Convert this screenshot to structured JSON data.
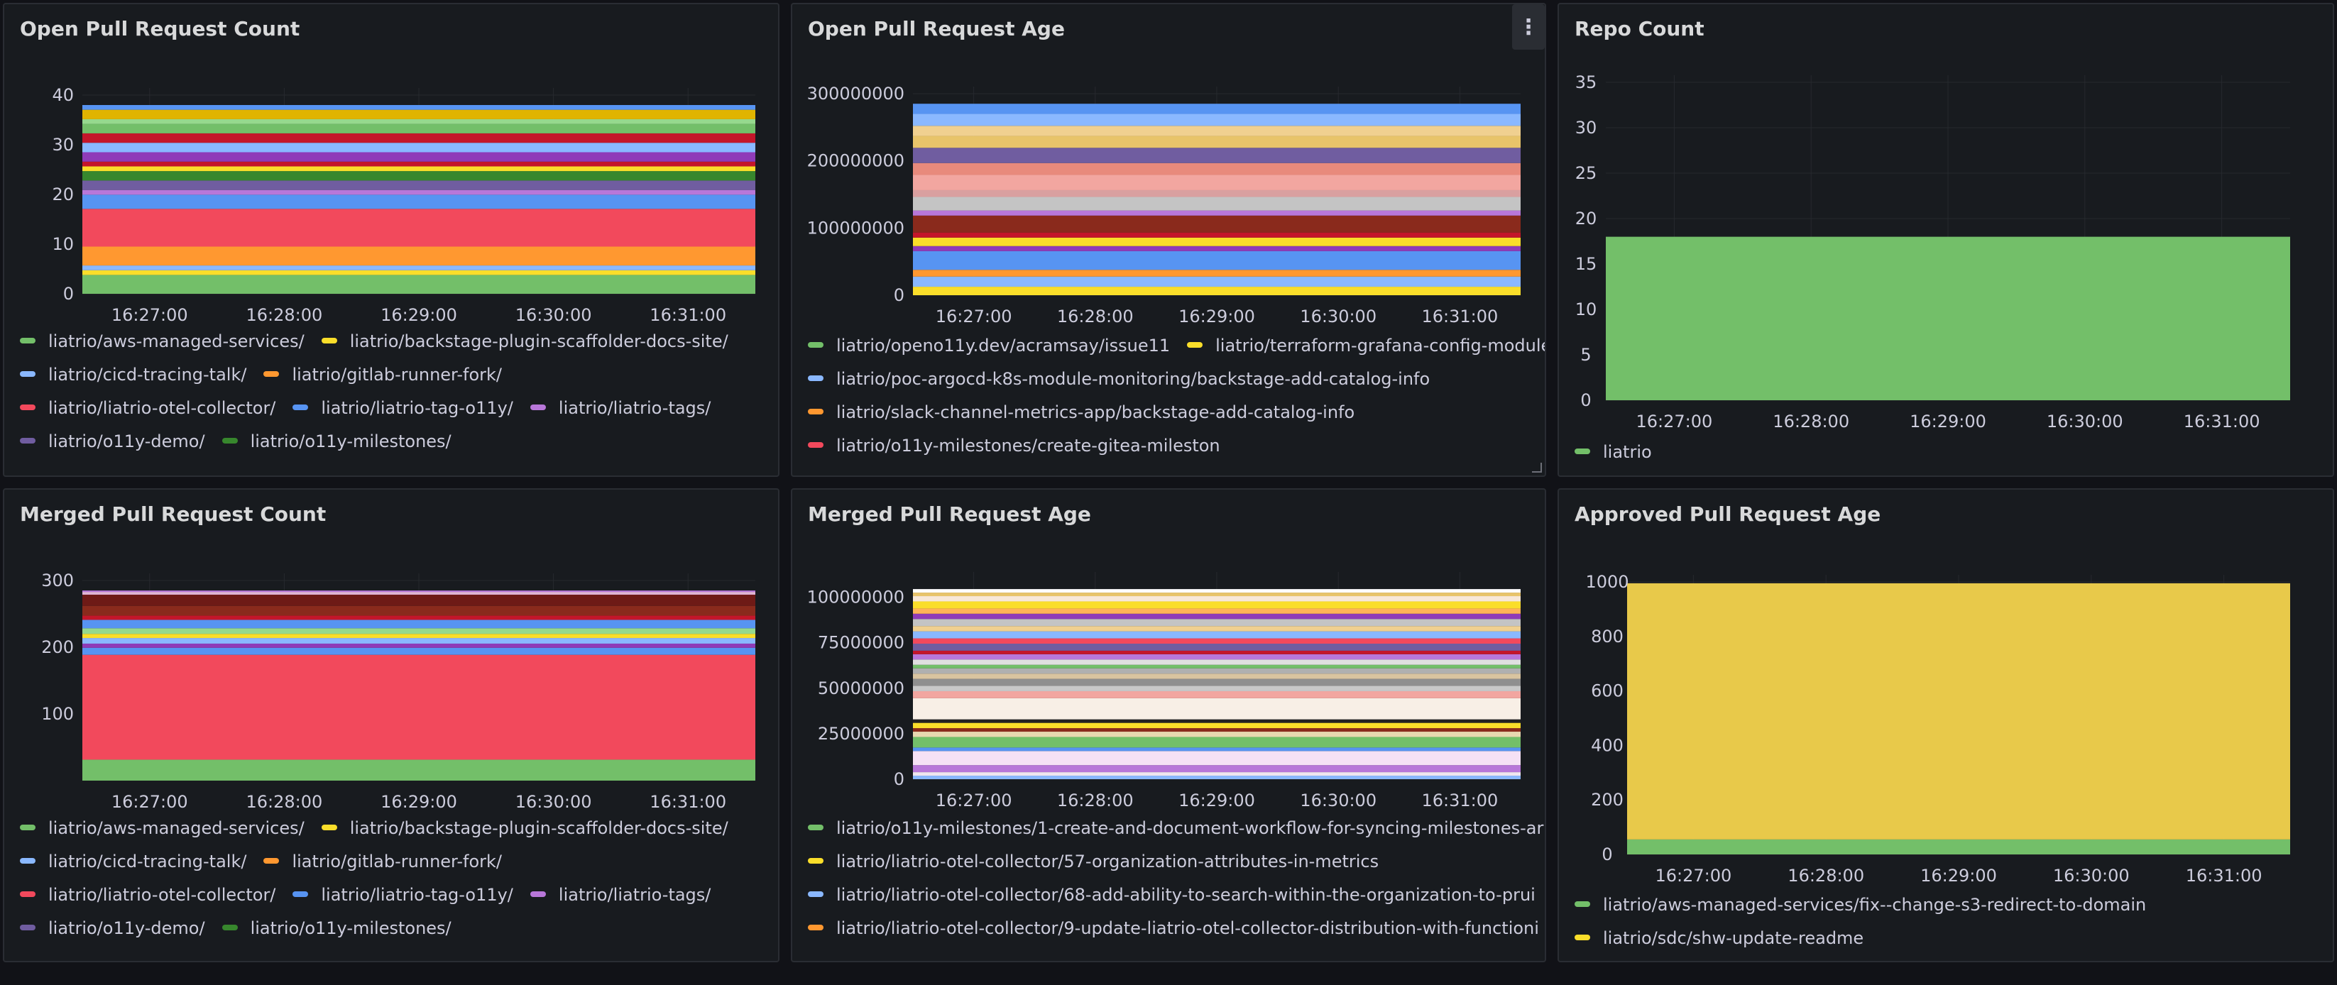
{
  "colors": {
    "background": "#111217",
    "panel": "#181b1f",
    "border": "#2a2d33",
    "text": "#ccccdc",
    "grid": "#26292e"
  },
  "panels": [
    {
      "id": "open-pr-count",
      "title": "Open Pull Request Count",
      "menu": false
    },
    {
      "id": "open-pr-age",
      "title": "Open Pull Request Age",
      "menu": true
    },
    {
      "id": "repo-count",
      "title": "Repo Count",
      "menu": false
    },
    {
      "id": "merged-pr-count",
      "title": "Merged Pull Request Count",
      "menu": false
    },
    {
      "id": "merged-pr-age",
      "title": "Merged Pull Request Age",
      "menu": false
    },
    {
      "id": "approved-pr-age",
      "title": "Approved Pull Request Age",
      "menu": false
    }
  ],
  "chart_data": [
    {
      "type": "area",
      "stacked": true,
      "title": "Open Pull Request Count",
      "x": [
        "16:27:00",
        "16:28:00",
        "16:29:00",
        "16:30:00",
        "16:31:00"
      ],
      "ylim": [
        0,
        40
      ],
      "yticks": [
        "0",
        "10",
        "20",
        "30",
        "40"
      ],
      "grid": true,
      "bands": [
        {
          "v": 4,
          "c": "#73bf69"
        },
        {
          "v": 1,
          "c": "#fade2a"
        },
        {
          "v": 1,
          "c": "#8ab8ff"
        },
        {
          "v": 4,
          "c": "#ff9830"
        },
        {
          "v": 8,
          "c": "#f2495c"
        },
        {
          "v": 3,
          "c": "#5794f2"
        },
        {
          "v": 1,
          "c": "#b877d9"
        },
        {
          "v": 2,
          "c": "#705da0"
        },
        {
          "v": 2,
          "c": "#37872d"
        },
        {
          "v": 1,
          "c": "#fade2a"
        },
        {
          "v": 1,
          "c": "#c4162a"
        },
        {
          "v": 2,
          "c": "#8f3bb8"
        },
        {
          "v": 2,
          "c": "#8ab8ff"
        },
        {
          "v": 2,
          "c": "#c4162a"
        },
        {
          "v": 2,
          "c": "#73bf69"
        },
        {
          "v": 1,
          "c": "#96d98d"
        },
        {
          "v": 2,
          "c": "#e0b400"
        },
        {
          "v": 1,
          "c": "#5794f2"
        }
      ],
      "legend": [
        [
          "liatrio/aws-managed-services/",
          "liatrio/backstage-plugin-scaffolder-docs-site/"
        ],
        [
          "liatrio/cicd-tracing-talk/",
          "liatrio/gitlab-runner-fork/"
        ],
        [
          "liatrio/liatrio-otel-collector/",
          "liatrio/liatrio-tag-o11y/",
          "liatrio/liatrio-tags/"
        ],
        [
          "liatrio/o11y-demo/",
          "liatrio/o11y-milestones/"
        ]
      ],
      "legend_colors": [
        [
          "#73bf69",
          "#fade2a"
        ],
        [
          "#8ab8ff",
          "#ff9830"
        ],
        [
          "#f2495c",
          "#5794f2",
          "#b877d9"
        ],
        [
          "#705da0",
          "#37872d"
        ]
      ]
    },
    {
      "type": "area",
      "stacked": true,
      "title": "Open Pull Request Age",
      "x": [
        "16:27:00",
        "16:28:00",
        "16:29:00",
        "16:30:00",
        "16:31:00"
      ],
      "ylim": [
        0,
        300000000
      ],
      "yticks": [
        "0",
        "100000000",
        "200000000",
        "300000000"
      ],
      "grid": true,
      "bands": [
        {
          "v": 10,
          "c": "#fade2a"
        },
        {
          "v": 12,
          "c": "#8ab8ff"
        },
        {
          "v": 8,
          "c": "#ff9830"
        },
        {
          "v": 22,
          "c": "#5794f2"
        },
        {
          "v": 6,
          "c": "#8f3bb8"
        },
        {
          "v": 10,
          "c": "#fade2a"
        },
        {
          "v": 6,
          "c": "#c4162a"
        },
        {
          "v": 20,
          "c": "#8a2a1c"
        },
        {
          "v": 6,
          "c": "#b877d9"
        },
        {
          "v": 16,
          "c": "#c4c4c4"
        },
        {
          "v": 8,
          "c": "#d9a0a0"
        },
        {
          "v": 18,
          "c": "#f2a6a0"
        },
        {
          "v": 14,
          "c": "#e88a7c"
        },
        {
          "v": 18,
          "c": "#705da0"
        },
        {
          "v": 14,
          "c": "#e8c46a"
        },
        {
          "v": 12,
          "c": "#f0d090"
        },
        {
          "v": 14,
          "c": "#8ab8ff"
        },
        {
          "v": 12,
          "c": "#5794f2"
        }
      ],
      "legend": [
        [
          "liatrio/openo11y.dev/acramsay/issue11",
          "liatrio/terraform-grafana-config-module/a"
        ],
        [
          "liatrio/poc-argocd-k8s-module-monitoring/backstage-add-catalog-info"
        ],
        [
          "liatrio/slack-channel-metrics-app/backstage-add-catalog-info"
        ],
        [
          "liatrio/o11y-milestones/create-gitea-mileston"
        ]
      ],
      "legend_colors": [
        [
          "#73bf69",
          "#fade2a"
        ],
        [
          "#8ab8ff"
        ],
        [
          "#ff9830"
        ],
        [
          "#f2495c"
        ]
      ]
    },
    {
      "type": "area",
      "stacked": false,
      "title": "Repo Count",
      "x": [
        "16:27:00",
        "16:28:00",
        "16:29:00",
        "16:30:00",
        "16:31:00"
      ],
      "ylim": [
        0,
        35
      ],
      "yticks": [
        "0",
        "5",
        "10",
        "15",
        "20",
        "25",
        "30",
        "35"
      ],
      "grid": true,
      "series": [
        {
          "name": "liatrio",
          "values": [
            18,
            18,
            18,
            18,
            18
          ],
          "color": "#73bf69"
        }
      ],
      "legend": [
        [
          "liatrio"
        ]
      ],
      "legend_colors": [
        [
          "#73bf69"
        ]
      ]
    },
    {
      "type": "area",
      "stacked": true,
      "title": "Merged Pull Request Count",
      "x": [
        "16:27:00",
        "16:28:00",
        "16:29:00",
        "16:30:00",
        "16:31:00"
      ],
      "ylim": [
        0,
        300
      ],
      "yticks": [
        "100",
        "200",
        "300"
      ],
      "grid": true,
      "bands": [
        {
          "v": 30,
          "c": "#73bf69"
        },
        {
          "v": 150,
          "c": "#f2495c"
        },
        {
          "v": 10,
          "c": "#5794f2"
        },
        {
          "v": 6,
          "c": "#8f3bb8"
        },
        {
          "v": 8,
          "c": "#8ab8ff"
        },
        {
          "v": 6,
          "c": "#fade2a"
        },
        {
          "v": 8,
          "c": "#96d98d"
        },
        {
          "v": 12,
          "c": "#5794f2"
        },
        {
          "v": 6,
          "c": "#c4162a"
        },
        {
          "v": 14,
          "c": "#8a2a1c"
        },
        {
          "v": 16,
          "c": "#6e1a16"
        },
        {
          "v": 4,
          "c": "#e0b4d4"
        },
        {
          "v": 2,
          "c": "#b877d9"
        }
      ],
      "legend": [
        [
          "liatrio/aws-managed-services/",
          "liatrio/backstage-plugin-scaffolder-docs-site/"
        ],
        [
          "liatrio/cicd-tracing-talk/",
          "liatrio/gitlab-runner-fork/"
        ],
        [
          "liatrio/liatrio-otel-collector/",
          "liatrio/liatrio-tag-o11y/",
          "liatrio/liatrio-tags/"
        ],
        [
          "liatrio/o11y-demo/",
          "liatrio/o11y-milestones/"
        ]
      ],
      "legend_colors": [
        [
          "#73bf69",
          "#fade2a"
        ],
        [
          "#8ab8ff",
          "#ff9830"
        ],
        [
          "#f2495c",
          "#5794f2",
          "#b877d9"
        ],
        [
          "#705da0",
          "#37872d"
        ]
      ]
    },
    {
      "type": "area",
      "stacked": true,
      "title": "Merged Pull Request Age",
      "x": [
        "16:27:00",
        "16:28:00",
        "16:29:00",
        "16:30:00",
        "16:31:00"
      ],
      "ylim": [
        0,
        110000000
      ],
      "yticks": [
        "0",
        "25000000",
        "50000000",
        "75000000",
        "100000000"
      ],
      "grid": true,
      "bands": [
        {
          "v": 2,
          "c": "#8ab8ff"
        },
        {
          "v": 2,
          "c": "#f0e6ef"
        },
        {
          "v": 4,
          "c": "#b877d9"
        },
        {
          "v": 8,
          "c": "#f5e1f5"
        },
        {
          "v": 2,
          "c": "#5794f2"
        },
        {
          "v": 6,
          "c": "#73bf69"
        },
        {
          "v": 3,
          "c": "#e8d8b0"
        },
        {
          "v": 2,
          "c": "#8a2a1c"
        },
        {
          "v": 3,
          "c": "#fade2a"
        },
        {
          "v": 2,
          "c": "#222222"
        },
        {
          "v": 12,
          "c": "#f8efe6"
        },
        {
          "v": 4,
          "c": "#f2a6a0"
        },
        {
          "v": 3,
          "c": "#c8c8c8"
        },
        {
          "v": 4,
          "c": "#8f8f8f"
        },
        {
          "v": 3,
          "c": "#d9c4a0"
        },
        {
          "v": 3,
          "c": "#b0b0b0"
        },
        {
          "v": 2,
          "c": "#73bf69"
        },
        {
          "v": 3,
          "c": "#e0e0e0"
        },
        {
          "v": 3,
          "c": "#b877d9"
        },
        {
          "v": 2,
          "c": "#c4162a"
        },
        {
          "v": 4,
          "c": "#705da0"
        },
        {
          "v": 3,
          "c": "#f2495c"
        },
        {
          "v": 4,
          "c": "#8ab8ff"
        },
        {
          "v": 3,
          "c": "#f0d090"
        },
        {
          "v": 4,
          "c": "#c4c4c4"
        },
        {
          "v": 3,
          "c": "#8f3bb8"
        },
        {
          "v": 3,
          "c": "#ffb357"
        },
        {
          "v": 4,
          "c": "#fade2a"
        },
        {
          "v": 3,
          "c": "#f8e8d8"
        },
        {
          "v": 2,
          "c": "#e8c46a"
        },
        {
          "v": 2,
          "c": "#ffffff"
        }
      ],
      "legend": [
        [
          "liatrio/o11y-milestones/1-create-and-document-workflow-for-syncing-milestones-ar"
        ],
        [
          "liatrio/liatrio-otel-collector/57-organization-attributes-in-metrics"
        ],
        [
          "liatrio/liatrio-otel-collector/68-add-ability-to-search-within-the-organization-to-prui"
        ],
        [
          "liatrio/liatrio-otel-collector/9-update-liatrio-otel-collector-distribution-with-functioni"
        ]
      ],
      "legend_colors": [
        [
          "#73bf69"
        ],
        [
          "#fade2a"
        ],
        [
          "#8ab8ff"
        ],
        [
          "#ff9830"
        ]
      ]
    },
    {
      "type": "area",
      "stacked": true,
      "title": "Approved Pull Request Age",
      "x": [
        "16:27:00",
        "16:28:00",
        "16:29:00",
        "16:30:00",
        "16:31:00"
      ],
      "ylim": [
        0,
        1000
      ],
      "yticks": [
        "0",
        "200",
        "400",
        "600",
        "800",
        "1000"
      ],
      "grid": true,
      "series": [
        {
          "name": "liatrio/aws-managed-services/fix--change-s3-redirect-to-domain",
          "values": [
            55,
            55,
            55,
            55,
            55
          ],
          "color": "#73bf69"
        },
        {
          "name": "liatrio/sdc/shw-update-readme",
          "values": [
            940,
            940,
            940,
            940,
            940
          ],
          "color": "#e8c94a"
        }
      ],
      "legend": [
        [
          "liatrio/aws-managed-services/fix--change-s3-redirect-to-domain"
        ],
        [
          "liatrio/sdc/shw-update-readme"
        ]
      ],
      "legend_colors": [
        [
          "#73bf69"
        ],
        [
          "#fade2a"
        ]
      ]
    }
  ]
}
